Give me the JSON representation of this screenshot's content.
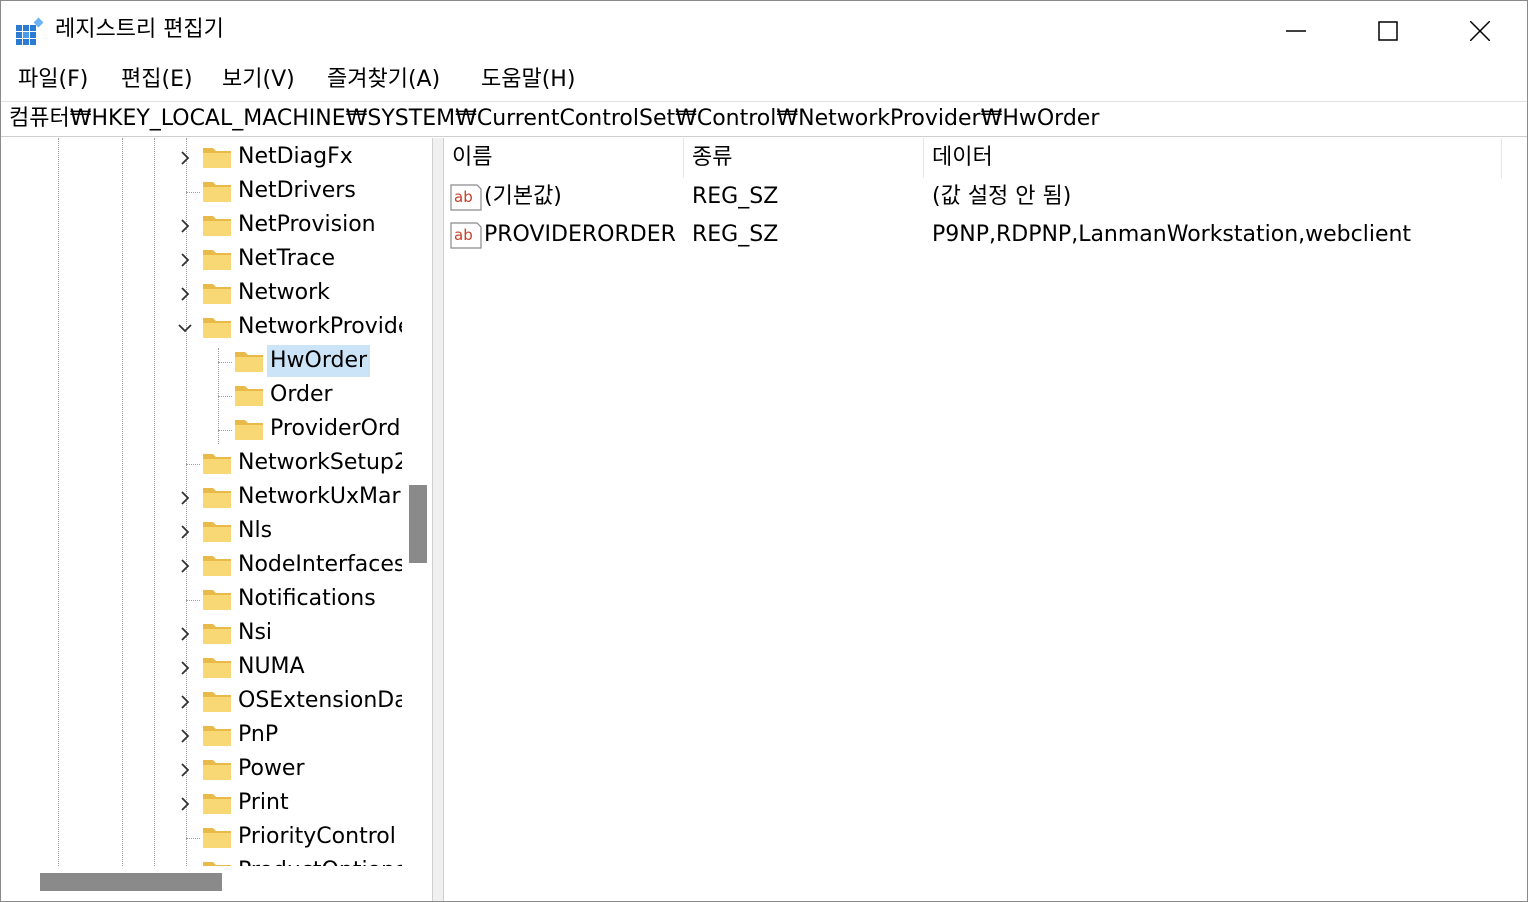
{
  "window": {
    "title": "레지스트리 편집기"
  },
  "menu": [
    "파일(F)",
    "편집(E)",
    "보기(V)",
    "즐겨찾기(A)",
    "도움말(H)"
  ],
  "address": "컴퓨터₩HKEY_LOCAL_MACHINE₩SYSTEM₩CurrentControlSet₩Control₩NetworkProvider₩HwOrder",
  "tree": [
    {
      "label": "NetDiagFx",
      "expander": "collapsed"
    },
    {
      "label": "NetDrivers",
      "expander": "none"
    },
    {
      "label": "NetProvision",
      "expander": "collapsed"
    },
    {
      "label": "NetTrace",
      "expander": "collapsed"
    },
    {
      "label": "Network",
      "expander": "collapsed"
    },
    {
      "label": "NetworkProvide",
      "expander": "expanded"
    },
    {
      "label": "HwOrder",
      "expander": "none",
      "selected": true,
      "child": true
    },
    {
      "label": "Order",
      "expander": "none",
      "child": true
    },
    {
      "label": "ProviderOrd",
      "expander": "none",
      "child": true
    },
    {
      "label": "NetworkSetup2",
      "expander": "none"
    },
    {
      "label": "NetworkUxMar",
      "expander": "collapsed"
    },
    {
      "label": "Nls",
      "expander": "collapsed"
    },
    {
      "label": "NodeInterfaces",
      "expander": "collapsed"
    },
    {
      "label": "Notifications",
      "expander": "none"
    },
    {
      "label": "Nsi",
      "expander": "collapsed"
    },
    {
      "label": "NUMA",
      "expander": "collapsed"
    },
    {
      "label": "OSExtensionDa",
      "expander": "collapsed"
    },
    {
      "label": "PnP",
      "expander": "collapsed"
    },
    {
      "label": "Power",
      "expander": "collapsed"
    },
    {
      "label": "Print",
      "expander": "collapsed"
    },
    {
      "label": "PriorityControl",
      "expander": "none"
    },
    {
      "label": "ProductOptions",
      "expander": "none"
    }
  ],
  "list": {
    "columns": [
      "이름",
      "종류",
      "데이터"
    ],
    "rows": [
      {
        "icon": "string-value-icon",
        "name": "(기본값)",
        "type": "REG_SZ",
        "data": "(값 설정 안 됨)"
      },
      {
        "icon": "string-value-icon",
        "name": "PROVIDERORDER",
        "type": "REG_SZ",
        "data": "P9NP,RDPNP,LanmanWorkstation,webclient"
      }
    ]
  },
  "colors": {
    "selection": "#cce4f7",
    "folder": "#f8d775",
    "scroll_thumb": "#8a8a8a"
  }
}
